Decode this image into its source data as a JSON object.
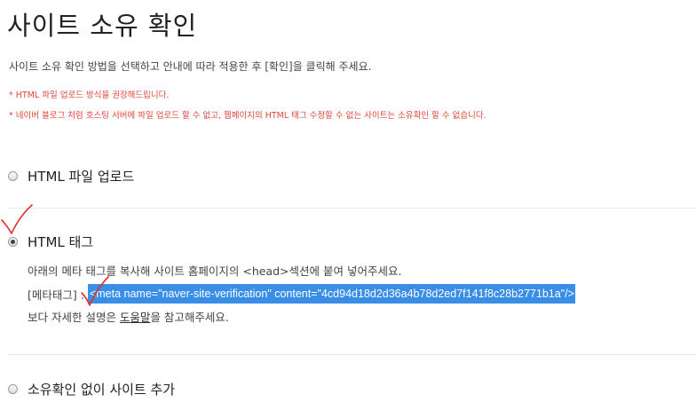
{
  "page": {
    "title": "사이트 소유 확인",
    "intro": "사이트 소유 확인 방법을 선택하고 안내에 따라 적용한 후 [확인]을 클릭해 주세요.",
    "notices": [
      "* HTML 파일 업로드 방식을 권장해드립니다.",
      "* 네이버 블로그 처럼 호스팅 서버에 파일 업로드 할 수 없고, 웹페이지의 HTML 태그 수정할 수 없는 사이트는 소유확인 할 수 없습니다."
    ]
  },
  "options": {
    "upload": {
      "label": "HTML 파일 업로드",
      "checked": false
    },
    "meta": {
      "label": "HTML 태그",
      "checked": true
    },
    "none": {
      "label": "소유확인 없이 사이트 추가",
      "checked": false
    }
  },
  "meta_section": {
    "description": "아래의 메타 태그를 복사해 사이트 홈페이지의 <head>섹션에 붙여 넣어주세요.",
    "tag_label": "[메타태그] :",
    "tag_code": "<meta name=\"naver-site-verification\" content=\"4cd94d18d2d36a4b78d2ed7f141f8c28b2771b1a\"/>",
    "help_prefix": "보다 자세한 설명은 ",
    "help_link": "도움말",
    "help_suffix": "을 참고해주세요."
  },
  "colors": {
    "notice": "#e0463c",
    "highlight": "#3a8ee6",
    "annotation": "#e0302a"
  },
  "icons": {
    "checkmark": "red-handwritten-checkmark-icon"
  }
}
